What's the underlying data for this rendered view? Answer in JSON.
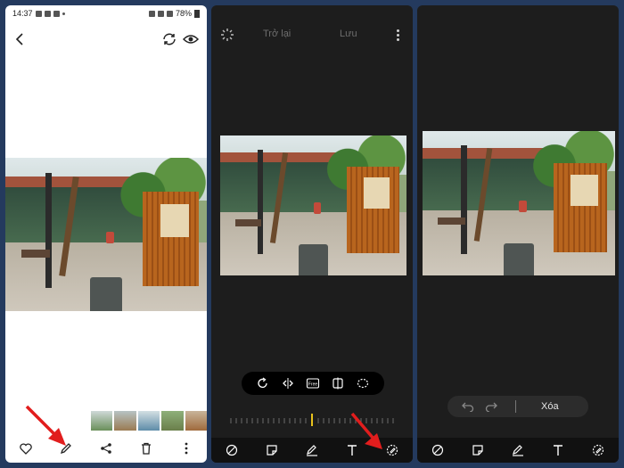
{
  "panel1": {
    "status": {
      "time": "14:37",
      "battery": "78%"
    },
    "icons": [
      "back-icon",
      "rotate-icon",
      "eye-icon",
      "heart-icon",
      "pencil-icon",
      "share-icon",
      "trash-icon",
      "more-icon"
    ]
  },
  "panel2": {
    "back_label": "Trở lại",
    "save_label": "Lưu",
    "tools": [
      "rotate-icon",
      "flip-icon",
      "free-icon",
      "aspect-icon",
      "lasso-icon"
    ],
    "free_label": "Free"
  },
  "panel3": {
    "erase_label": "Xóa"
  },
  "colors": {
    "accent": "#e11d1d",
    "dark_bg": "#1d1d1d",
    "dial_marker": "#e8c21c"
  }
}
